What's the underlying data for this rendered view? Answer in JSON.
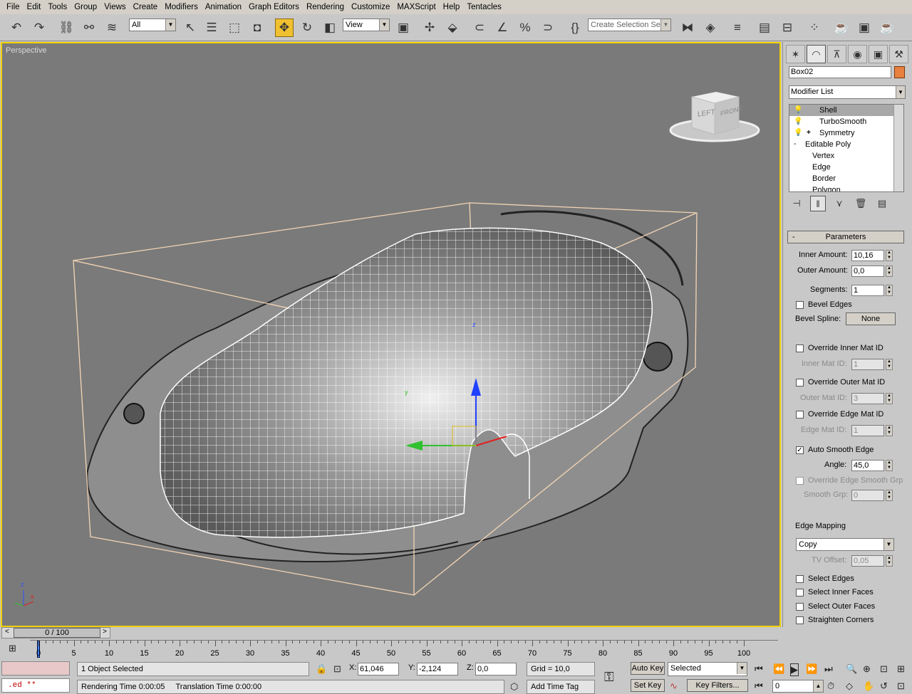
{
  "menu": [
    "File",
    "Edit",
    "Tools",
    "Group",
    "Views",
    "Create",
    "Modifiers",
    "Animation",
    "Graph Editors",
    "Rendering",
    "Customize",
    "MAXScript",
    "Help",
    "Tentacles"
  ],
  "toolbar": {
    "filter_value": "All",
    "refcoord_value": "View",
    "selection_set_placeholder": "Create Selection Set"
  },
  "viewport": {
    "label": "Perspective",
    "viewcube_left": "LEFT",
    "viewcube_front": "FRONT"
  },
  "command_panel": {
    "object_name": "Box02",
    "object_color": "#e88040",
    "modifier_list_label": "Modifier List",
    "stack": [
      {
        "label": "Shell",
        "selected": true,
        "icon": "lightbulb-icon"
      },
      {
        "label": "TurboSmooth",
        "selected": false,
        "icon": "lightbulb-icon"
      },
      {
        "label": "Symmetry",
        "selected": false,
        "icon": "lightbulb-icon",
        "expand": "+"
      },
      {
        "label": "Editable Poly",
        "selected": false,
        "expand": "-"
      },
      {
        "label": "Vertex",
        "sub": true
      },
      {
        "label": "Edge",
        "sub": true
      },
      {
        "label": "Border",
        "sub": true
      },
      {
        "label": "Polygon",
        "sub": true
      }
    ],
    "parameters": {
      "title": "Parameters",
      "collapse": "-",
      "inner_amount_label": "Inner Amount:",
      "inner_amount": "10,16",
      "outer_amount_label": "Outer Amount:",
      "outer_amount": "0,0",
      "segments_label": "Segments:",
      "segments": "1",
      "bevel_edges_label": "Bevel Edges",
      "bevel_spline_label": "Bevel Spline:",
      "bevel_spline_value": "None",
      "override_inner_label": "Override Inner Mat ID",
      "inner_mat_id_label": "Inner Mat ID:",
      "inner_mat_id": "1",
      "override_outer_label": "Override Outer Mat ID",
      "outer_mat_id_label": "Outer Mat ID:",
      "outer_mat_id": "3",
      "override_edge_label": "Override Edge Mat ID",
      "edge_mat_id_label": "Edge Mat ID:",
      "edge_mat_id": "1",
      "auto_smooth_label": "Auto Smooth Edge",
      "auto_smooth_checked": "✓",
      "angle_label": "Angle:",
      "angle": "45,0",
      "override_smooth_label": "Override Edge Smooth Grp",
      "smooth_grp_label": "Smooth Grp:",
      "smooth_grp": "0",
      "edge_mapping_label": "Edge Mapping",
      "edge_mapping_value": "Copy",
      "tv_offset_label": "TV Offset:",
      "tv_offset": "0,05",
      "select_edges_label": "Select Edges",
      "select_inner_label": "Select Inner Faces",
      "select_outer_label": "Select Outer Faces",
      "straighten_label": "Straighten Corners"
    }
  },
  "timeline": {
    "slider_label": "0 / 100",
    "prev": "<",
    "next": ">",
    "ticks": [
      "0",
      "5",
      "10",
      "15",
      "20",
      "25",
      "30",
      "35",
      "40",
      "45",
      "50",
      "55",
      "60",
      "65",
      "70",
      "75",
      "80",
      "85",
      "90",
      "95",
      "100"
    ]
  },
  "status": {
    "listener_text": ".ed **",
    "selected_text": "1 Object Selected",
    "render_time": "Rendering Time  0:00:05",
    "translation_time": "Translation Time  0:00:00",
    "x_label": "X:",
    "x_value": "61,046",
    "y_label": "Y:",
    "y_value": "-2,124",
    "z_label": "Z:",
    "z_value": "0,0",
    "grid": "Grid = 10,0",
    "add_time_tag": "Add Time Tag",
    "auto_key": "Auto Key",
    "set_key": "Set Key",
    "key_mode": "Selected",
    "key_filters": "Key Filters...",
    "frame_value": "0"
  }
}
